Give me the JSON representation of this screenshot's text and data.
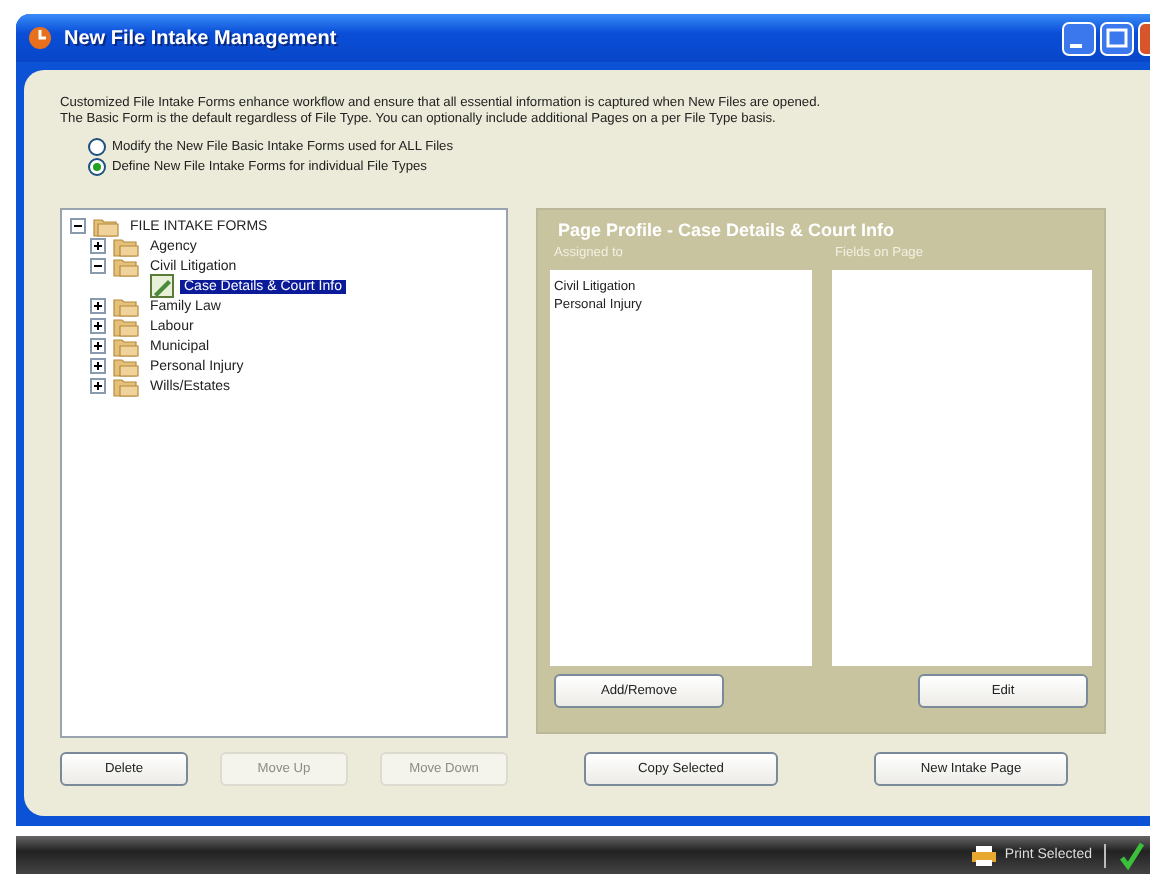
{
  "window": {
    "title": "New File Intake Management"
  },
  "description": [
    "Customized File Intake Forms enhance workflow and ensure that all essential information is captured when New Files are opened.",
    "The Basic Form is the default regardless of File Type. You can optionally include additional Pages on a per File Type basis."
  ],
  "options": [
    {
      "label": "Modify the New File Basic Intake Forms used for ALL Files",
      "selected": false
    },
    {
      "label": "Define New File Intake Forms for individual File Types",
      "selected": true
    }
  ],
  "tree": {
    "label": "FILE INTAKE FORMS",
    "kind": "root",
    "expanded": true,
    "selected": false,
    "children": [
      {
        "label": "Agency",
        "kind": "folder",
        "expanded": false,
        "selected": false
      },
      {
        "label": "Civil Litigation",
        "kind": "folder",
        "expanded": true,
        "selected": false,
        "children": [
          {
            "label": "Case Details & Court Info",
            "kind": "page",
            "selected": true
          }
        ]
      },
      {
        "label": "Family Law",
        "kind": "folder",
        "expanded": false,
        "selected": false
      },
      {
        "label": "Labour",
        "kind": "folder",
        "expanded": false,
        "selected": false
      },
      {
        "label": "Municipal",
        "kind": "folder",
        "expanded": false,
        "selected": false
      },
      {
        "label": "Personal Injury",
        "kind": "folder",
        "expanded": false,
        "selected": false
      },
      {
        "label": "Wills/Estates",
        "kind": "folder",
        "expanded": false,
        "selected": false
      }
    ]
  },
  "page_profile": {
    "title": "Page Profile - Case Details & Court Info",
    "assigned_heading": "Assigned to",
    "assigned": [
      "Civil Litigation",
      "Personal Injury"
    ],
    "fields_heading": "Fields on Page",
    "buttons": [
      {
        "label": "Add/Remove"
      },
      {
        "label": "Edit"
      }
    ]
  },
  "buttons": [
    {
      "label": "Delete",
      "disabled": false
    },
    {
      "label": "Move Up",
      "disabled": true
    },
    {
      "label": "Move Down",
      "disabled": true
    },
    {
      "label": "Copy Selected",
      "disabled": false
    },
    {
      "label": "New Intake Page",
      "disabled": false
    }
  ],
  "status_bar": {
    "print": "Print Selected"
  }
}
